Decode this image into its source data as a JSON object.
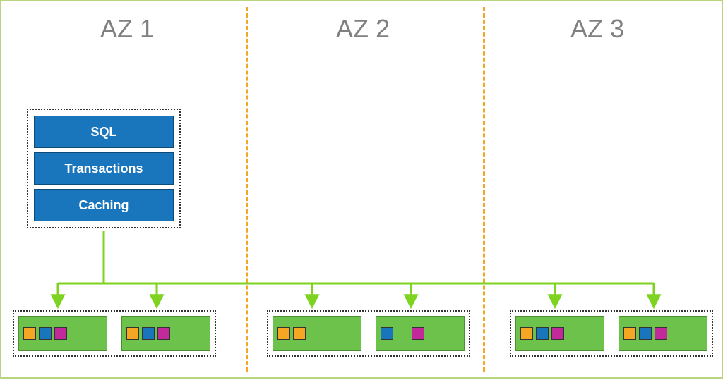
{
  "zones": {
    "az1": "AZ 1",
    "az2": "AZ 2",
    "az3": "AZ 3"
  },
  "stack": {
    "sql": "SQL",
    "transactions": "Transactions",
    "caching": "Caching"
  },
  "colors": {
    "green": "#6cc24a",
    "blue": "#1976bd",
    "orange": "#f5a623",
    "magenta": "#c2299a",
    "connector": "#7ed321",
    "divider": "#f5a623",
    "label": "#808080"
  },
  "nodes": {
    "az1": [
      {
        "chips": [
          "orange",
          "blue",
          "magenta"
        ]
      },
      {
        "chips": [
          "orange",
          "blue",
          "magenta"
        ]
      }
    ],
    "az2": [
      {
        "chips": [
          "orange",
          "orange"
        ]
      },
      {
        "chips": [
          "blue",
          "spacer",
          "magenta"
        ]
      }
    ],
    "az3": [
      {
        "chips": [
          "orange",
          "blue",
          "magenta"
        ]
      },
      {
        "chips": [
          "orange",
          "blue",
          "magenta"
        ]
      }
    ]
  }
}
